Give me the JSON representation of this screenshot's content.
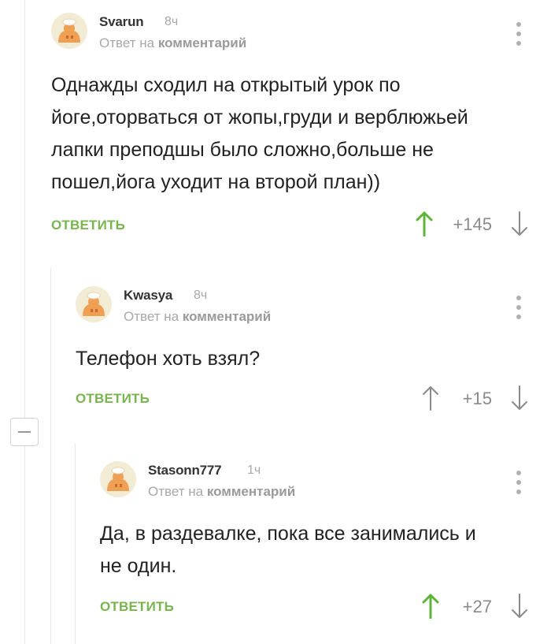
{
  "comments": [
    {
      "author": "Svarun",
      "time": "8ч",
      "reply_prefix": "Ответ на",
      "reply_link": "комментарий",
      "lines": [
        "Однажды сходил на открытый урок по",
        "йоге,оторваться от жопы,груди и верблюжьей",
        "лапки преподшы было сложно,больше не",
        "пошел,йога уходит на второй план))"
      ],
      "reply_label": "ОТВЕТИТЬ",
      "rating": "+145",
      "upvoted": true
    },
    {
      "author": "Kwasya",
      "time": "8ч",
      "reply_prefix": "Ответ на",
      "reply_link": "комментарий",
      "lines": [
        "Телефон хоть взял?"
      ],
      "reply_label": "ОТВЕТИТЬ",
      "rating": "+15",
      "upvoted": false
    },
    {
      "author": "Stasonn777",
      "time": "1ч",
      "reply_prefix": "Ответ на",
      "reply_link": "комментарий",
      "lines": [
        "Да, в раздевалке, пока все занимались и",
        "не один."
      ],
      "reply_label": "ОТВЕТИТЬ",
      "rating": "+27",
      "upvoted": true
    }
  ],
  "colors": {
    "accent_green": "#78b54f",
    "upvote_active": "#5fb336",
    "arrow_default": "#8a8a8a",
    "muted_text": "#a8a8a8",
    "avatar_bg": "#f3ecd4",
    "avatar_figure": "#f0a055"
  },
  "icons": [
    "default-avatar-icon",
    "more-options-icon",
    "upvote-arrow-icon",
    "downvote-arrow-icon",
    "collapse-thread-icon"
  ]
}
